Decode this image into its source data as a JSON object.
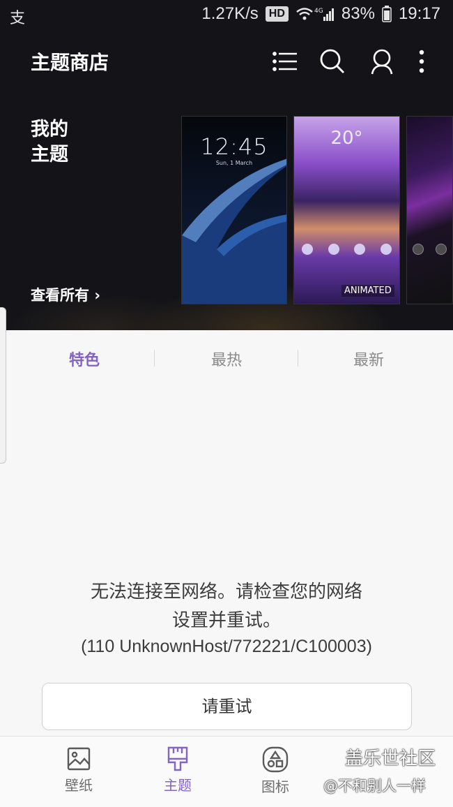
{
  "status_bar": {
    "carrier_glyph": "支",
    "speed": "1.27K/s",
    "hd": "HD",
    "network": "4G",
    "battery": "83%",
    "time": "19:17"
  },
  "header": {
    "title": "主题商店",
    "icons": [
      "list-icon",
      "search-icon",
      "account-icon",
      "more-icon"
    ]
  },
  "my_themes": {
    "heading_line1": "我的",
    "heading_line2": "主题",
    "view_all": "查看所有",
    "thumbnails": [
      {
        "clock": "12:45",
        "date": "Sun, 1 March"
      },
      {
        "clock": "20°",
        "badge": "ANIMATED"
      },
      {}
    ]
  },
  "tabs": [
    {
      "label": "特色",
      "active": true
    },
    {
      "label": "最热",
      "active": false
    },
    {
      "label": "最新",
      "active": false
    }
  ],
  "error": {
    "line1": "无法连接至网络。请检查您的网络",
    "line2": "设置并重试。",
    "code": "(110 UnknownHost/772221/C100003)"
  },
  "retry_label": "请重试",
  "bottom_nav": [
    {
      "label": "壁纸",
      "icon": "wallpaper-icon",
      "active": false
    },
    {
      "label": "主题",
      "icon": "theme-brush-icon",
      "active": true
    },
    {
      "label": "图标",
      "icon": "icon-shapes-icon",
      "active": false
    }
  ],
  "watermark": {
    "line1": "盖乐世社区",
    "line2": "@不和别人一样"
  },
  "colors": {
    "accent": "#8463c6",
    "header_bg": "#141418",
    "page_bg": "#f7f7f7"
  }
}
